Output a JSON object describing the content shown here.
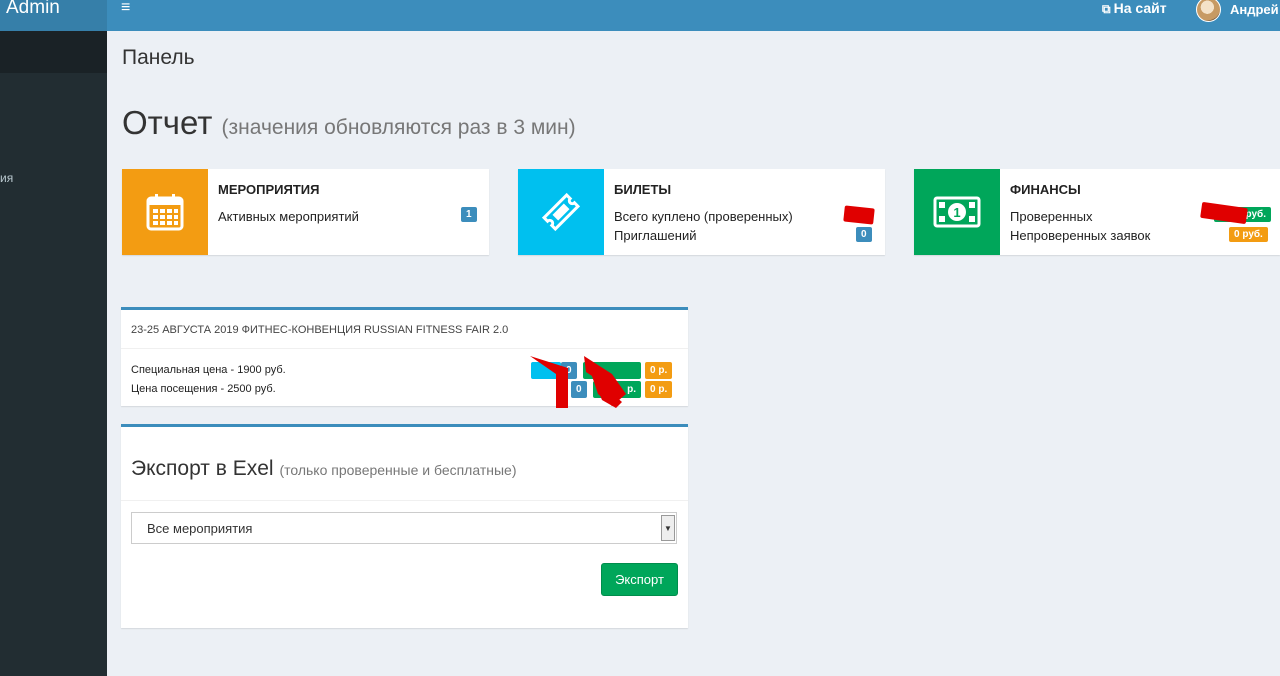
{
  "header": {
    "logo": "Admin",
    "menu_icon": "≡",
    "site_link": "На сайт",
    "site_link_icon": "external-link-icon",
    "user_name": "Андрей"
  },
  "sidebar": {
    "item_partial": "ия"
  },
  "page": {
    "title": "Панель",
    "report_title": "Отчет",
    "report_subtitle": "(значения обновляются раз в 3 мин)"
  },
  "stats": {
    "events": {
      "title": "МЕРОПРИЯТИЯ",
      "row1": "Активных мероприятий",
      "row1_badge": "1",
      "color": "#f39c12",
      "icon": "calendar-icon"
    },
    "tickets": {
      "title": "БИЛЕТЫ",
      "row1": "Всего куплено (проверенных)",
      "row2": "Приглашений",
      "row2_badge": "0",
      "color": "#00c0ef",
      "icon": "ticket-icon"
    },
    "finance": {
      "title": "ФИНАНСЫ",
      "row1": "Проверенных",
      "row1_badge": "руб.",
      "row2": "Непроверенных заявок",
      "row2_badge": "0 руб.",
      "color": "#00a65a",
      "icon": "money-icon"
    }
  },
  "event": {
    "title": "23-25 АВГУСТА 2019 ФИТНЕС-КОНВЕНЦИЯ RUSSIAN FITNESS FAIR 2.0",
    "prices": [
      {
        "label": "Специальная цена - 1900 руб.",
        "count": "0",
        "money_partial": "",
        "unverified": "0 р."
      },
      {
        "label": "Цена посещения - 2500 руб.",
        "count": "0",
        "money_partial": "р.",
        "unverified": "0 р."
      }
    ]
  },
  "export": {
    "title": "Экспорт в Exel",
    "subtitle": "(только проверенные и бесплатные)",
    "select_value": "Все мероприятия",
    "button": "Экспорт"
  }
}
